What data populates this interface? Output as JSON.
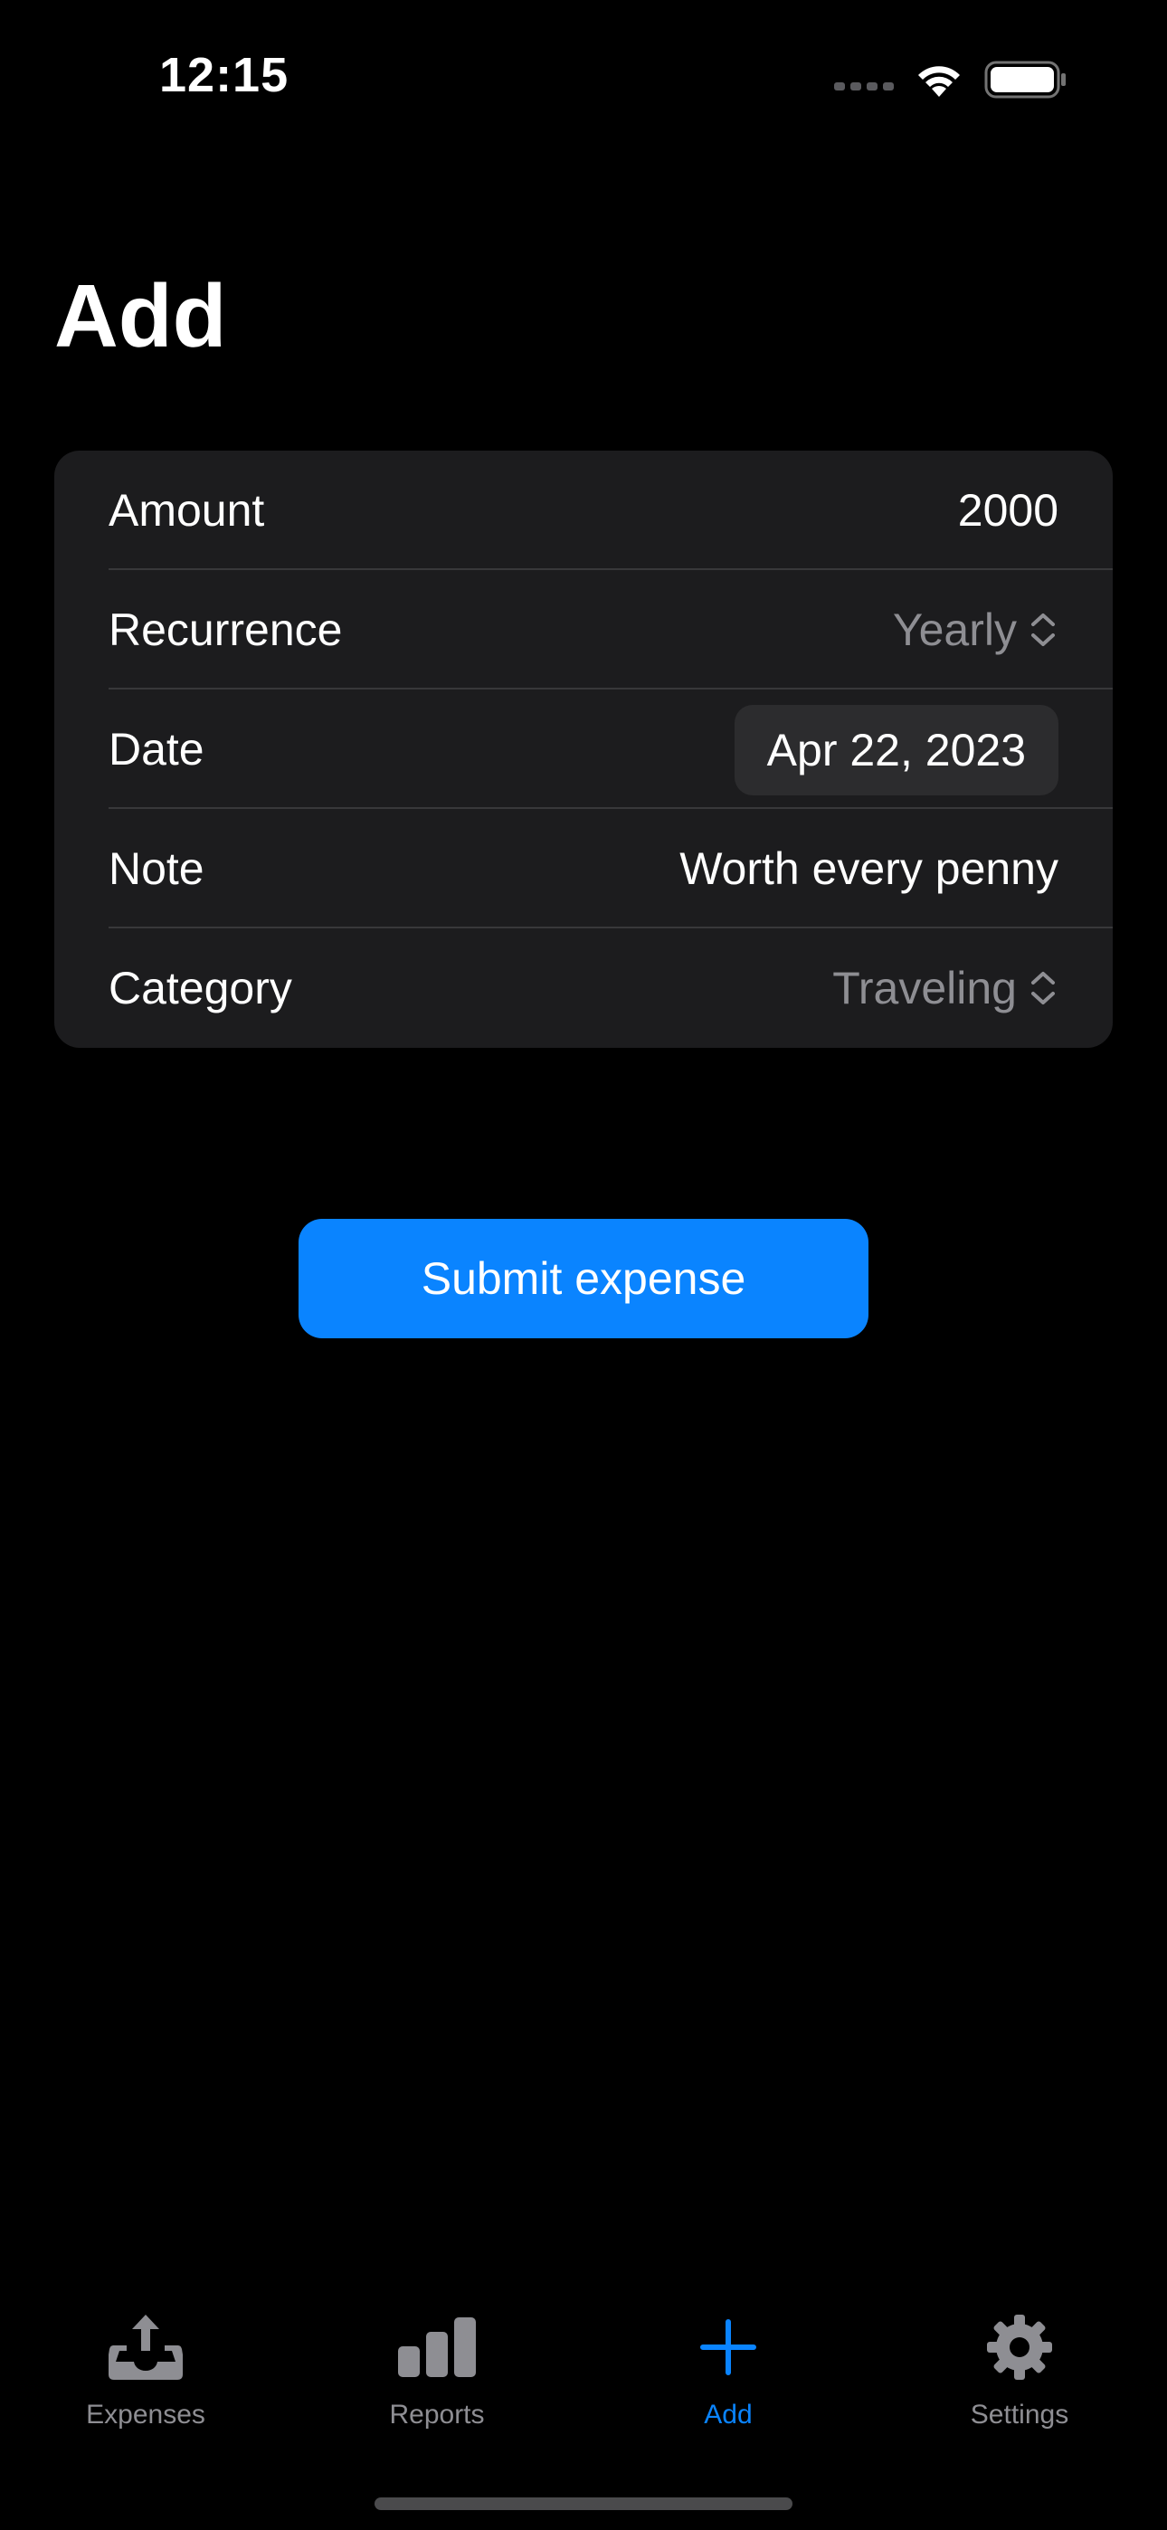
{
  "status_bar": {
    "time": "12:15",
    "battery_level": 1.0
  },
  "page": {
    "title": "Add"
  },
  "form": {
    "amount": {
      "label": "Amount",
      "value": "2000"
    },
    "recurrence": {
      "label": "Recurrence",
      "value": "Yearly"
    },
    "date": {
      "label": "Date",
      "value": "Apr 22, 2023"
    },
    "note": {
      "label": "Note",
      "value": "Worth every penny"
    },
    "category": {
      "label": "Category",
      "value": "Traveling"
    }
  },
  "submit": {
    "label": "Submit expense"
  },
  "tabs": [
    {
      "label": "Expenses",
      "icon": "tray-upload-icon",
      "active": false
    },
    {
      "label": "Reports",
      "icon": "bar-chart-icon",
      "active": false
    },
    {
      "label": "Add",
      "icon": "plus-icon",
      "active": true
    },
    {
      "label": "Settings",
      "icon": "gear-icon",
      "active": false
    }
  ],
  "colors": {
    "background": "#000000",
    "card": "#1c1c1e",
    "accent": "#0a84ff",
    "secondary_text": "#8e8e93"
  }
}
